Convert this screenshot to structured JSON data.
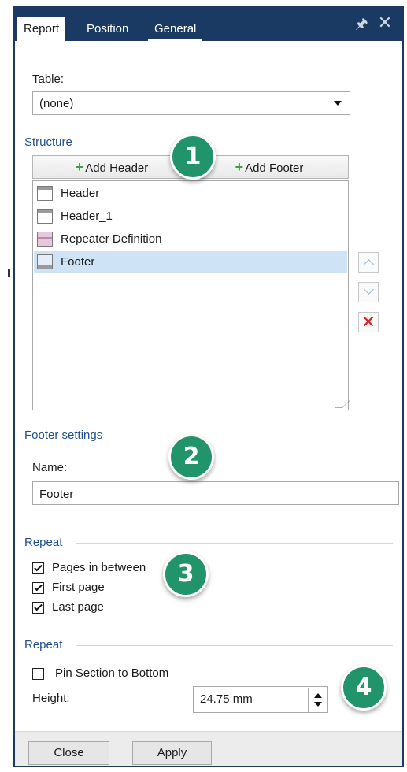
{
  "tabs": [
    {
      "label": "Report",
      "active": true
    },
    {
      "label": "Position",
      "active": false
    },
    {
      "label": "General",
      "active": false
    }
  ],
  "titlebar_icons": [
    "pin-icon",
    "close-icon"
  ],
  "table": {
    "label": "Table:",
    "selected": "(none)"
  },
  "structure": {
    "heading": "Structure",
    "add_header_label": "Add Header",
    "add_footer_label": "Add Footer",
    "items": [
      {
        "label": "Header",
        "icon": "header-section-icon",
        "selected": false
      },
      {
        "label": "Header_1",
        "icon": "header-section-icon",
        "selected": false
      },
      {
        "label": "Repeater Definition",
        "icon": "repeater-section-icon",
        "selected": false
      },
      {
        "label": "Footer",
        "icon": "footer-section-icon",
        "selected": true
      }
    ],
    "side_buttons": [
      "move-up-icon",
      "move-down-icon",
      "delete-icon"
    ]
  },
  "footer_settings": {
    "heading": "Footer settings",
    "name_label": "Name:",
    "name_value": "Footer"
  },
  "repeat": {
    "heading": "Repeat",
    "options": [
      {
        "label": "Pages in between",
        "checked": true
      },
      {
        "label": "First page",
        "checked": true
      },
      {
        "label": "Last page",
        "checked": true
      }
    ]
  },
  "repeat2": {
    "heading": "Repeat",
    "pin_label": "Pin Section to Bottom",
    "pin_checked": false,
    "height_label": "Height:",
    "height_value": "24.75 mm"
  },
  "buttons": {
    "close": "Close",
    "apply": "Apply"
  },
  "callouts": [
    "1",
    "2",
    "3",
    "4"
  ],
  "colors": {
    "titlebar": "#1a3a63",
    "section_heading": "#1f4e8a",
    "callout": "#22946b",
    "selection": "#cfe3f6",
    "delete": "#d22222"
  }
}
